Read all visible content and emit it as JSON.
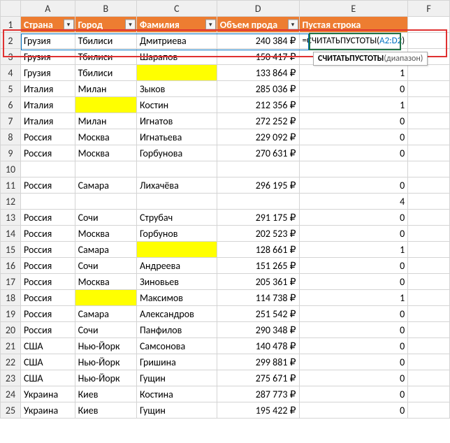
{
  "columns": [
    "A",
    "B",
    "C",
    "D",
    "E",
    "F"
  ],
  "headers": {
    "A": "Страна",
    "B": "Город",
    "C": "Фамилия",
    "D": "Объем прода",
    "E": "Пустая строка"
  },
  "formula": {
    "prefix": "=СЧИТАТЬПУСТОТЫ(",
    "ref": "A2:D2",
    "suffix": ")"
  },
  "tooltip": {
    "func": "СЧИТАТЬПУСТОТЫ",
    "arg": "(диапазон)"
  },
  "rows": [
    {
      "n": 2,
      "A": "Грузия",
      "B": "Тбилиси",
      "C": "Дмитриева",
      "D": "240 384 ₽",
      "E": "_FORMULA_"
    },
    {
      "n": 3,
      "A": "Грузия",
      "B": "Тбилиси",
      "C": "Шарапов",
      "D": "150 417 ₽",
      "E": ""
    },
    {
      "n": 4,
      "A": "Грузия",
      "B": "Тбилиси",
      "C": "",
      "Cy": true,
      "D": "133 864 ₽",
      "E": "1"
    },
    {
      "n": 5,
      "A": "Италия",
      "B": "Милан",
      "C": "Зыков",
      "D": "285 036 ₽",
      "E": "0"
    },
    {
      "n": 6,
      "A": "Италия",
      "B": "",
      "By": true,
      "C": "Костин",
      "D": "212 356 ₽",
      "E": "1"
    },
    {
      "n": 7,
      "A": "Италия",
      "B": "Милан",
      "C": "Игнатов",
      "D": "272 252 ₽",
      "E": "0"
    },
    {
      "n": 8,
      "A": "Россия",
      "B": "Москва",
      "C": "Игнатьева",
      "D": "229 092 ₽",
      "E": "0"
    },
    {
      "n": 9,
      "A": "Россия",
      "B": "Москва",
      "C": "Горбунова",
      "D": "270 631 ₽",
      "E": "0"
    },
    {
      "n": 10,
      "A": "",
      "B": "",
      "C": "",
      "D": "",
      "E": ""
    },
    {
      "n": 11,
      "A": "Россия",
      "B": "Самара",
      "C": "Лихачёва",
      "D": "296 195 ₽",
      "E": "0"
    },
    {
      "n": 12,
      "A": "",
      "B": "",
      "C": "",
      "D": "",
      "E": "4"
    },
    {
      "n": 13,
      "A": "Россия",
      "B": "Сочи",
      "C": "Струбач",
      "D": "291 175 ₽",
      "E": "0"
    },
    {
      "n": 14,
      "A": "Россия",
      "B": "Москва",
      "C": "Горбунов",
      "D": "202 523 ₽",
      "E": "0"
    },
    {
      "n": 15,
      "A": "Россия",
      "B": "Самара",
      "C": "",
      "Cy": true,
      "D": "128 661 ₽",
      "E": "1"
    },
    {
      "n": 16,
      "A": "Россия",
      "B": "Сочи",
      "C": "Андреева",
      "D": "151 265 ₽",
      "E": "0"
    },
    {
      "n": 17,
      "A": "Россия",
      "B": "Москва",
      "C": "Зиновьев",
      "D": "205 361 ₽",
      "E": "0"
    },
    {
      "n": 18,
      "A": "Россия",
      "B": "",
      "By": true,
      "C": "Максимов",
      "D": "114 738 ₽",
      "E": "1"
    },
    {
      "n": 19,
      "A": "Россия",
      "B": "Самара",
      "C": "Александров",
      "D": "251 542 ₽",
      "E": "0"
    },
    {
      "n": 20,
      "A": "Россия",
      "B": "Сочи",
      "C": "Панфилов",
      "D": "290 348 ₽",
      "E": "0"
    },
    {
      "n": 21,
      "A": "США",
      "B": "Нью-Йорк",
      "C": "Самсонова",
      "D": "140 478 ₽",
      "E": "0"
    },
    {
      "n": 22,
      "A": "США",
      "B": "Нью-Йорк",
      "C": "Гришина",
      "D": "299 881 ₽",
      "E": "0"
    },
    {
      "n": 23,
      "A": "США",
      "B": "Нью-Йорк",
      "C": "Гущин",
      "D": "275 671 ₽",
      "E": "0"
    },
    {
      "n": 24,
      "A": "Украина",
      "B": "Киев",
      "C": "Костина",
      "D": "287 773 ₽",
      "E": "0"
    },
    {
      "n": 25,
      "A": "Украина",
      "B": "Киев",
      "C": "Гущин",
      "D": "195 422 ₽",
      "E": "0"
    }
  ],
  "chart_data": {
    "type": "table",
    "columns": [
      "Страна",
      "Город",
      "Фамилия",
      "Объем продаж ₽",
      "Пустая строка"
    ],
    "rows": [
      [
        "Грузия",
        "Тбилиси",
        "Дмитриева",
        240384,
        null
      ],
      [
        "Грузия",
        "Тбилиси",
        "Шарапов",
        150417,
        null
      ],
      [
        "Грузия",
        "Тбилиси",
        null,
        133864,
        1
      ],
      [
        "Италия",
        "Милан",
        "Зыков",
        285036,
        0
      ],
      [
        "Италия",
        null,
        "Костин",
        212356,
        1
      ],
      [
        "Италия",
        "Милан",
        "Игнатов",
        272252,
        0
      ],
      [
        "Россия",
        "Москва",
        "Игнатьева",
        229092,
        0
      ],
      [
        "Россия",
        "Москва",
        "Горбунова",
        270631,
        0
      ],
      [
        null,
        null,
        null,
        null,
        null
      ],
      [
        "Россия",
        "Самара",
        "Лихачёва",
        296195,
        0
      ],
      [
        null,
        null,
        null,
        null,
        4
      ],
      [
        "Россия",
        "Сочи",
        "Струбач",
        291175,
        0
      ],
      [
        "Россия",
        "Москва",
        "Горбунов",
        202523,
        0
      ],
      [
        "Россия",
        "Самара",
        null,
        128661,
        1
      ],
      [
        "Россия",
        "Сочи",
        "Андреева",
        151265,
        0
      ],
      [
        "Россия",
        "Москва",
        "Зиновьев",
        205361,
        0
      ],
      [
        "Россия",
        null,
        "Максимов",
        114738,
        1
      ],
      [
        "Россия",
        "Самара",
        "Александров",
        251542,
        0
      ],
      [
        "Россия",
        "Сочи",
        "Панфилов",
        290348,
        0
      ],
      [
        "США",
        "Нью-Йорк",
        "Самсонова",
        140478,
        0
      ],
      [
        "США",
        "Нью-Йорк",
        "Гришина",
        299881,
        0
      ],
      [
        "США",
        "Нью-Йорк",
        "Гущин",
        275671,
        0
      ],
      [
        "Украина",
        "Киев",
        "Костина",
        287773,
        0
      ],
      [
        "Украина",
        "Киев",
        "Гущин",
        195422,
        0
      ]
    ]
  }
}
